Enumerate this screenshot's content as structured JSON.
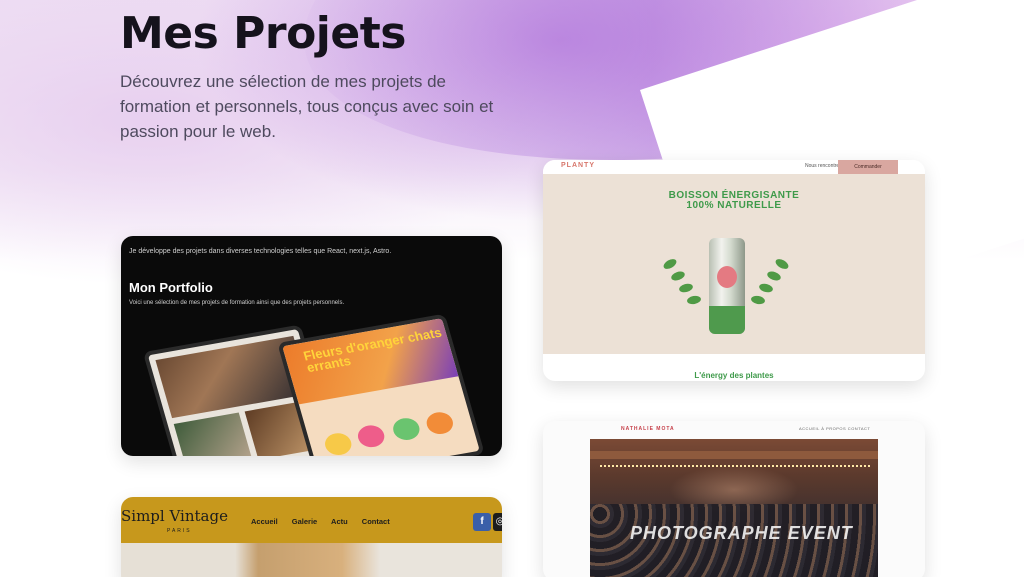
{
  "hero": {
    "title": "Mes Projets",
    "description": "Découvrez une sélection de mes projets de formation et personnels, tous conçus avec soin et passion pour le web."
  },
  "projects": [
    {
      "id": "portfolio",
      "intro": "Je développe des projets dans diverses technologies telles que React, next.js, Astro.",
      "title": "Mon Portfolio",
      "subtitle": "Voici une sélection de mes projets de formation ainsi que des projets personnels.",
      "screen_text": "Fleurs d'oranger chats errants"
    },
    {
      "id": "planty",
      "logo": "PLANTY",
      "nav_link": "Nous rencontrer",
      "cta": "Commander",
      "headline_line1": "BOISSON ÉNERGISANTE",
      "headline_line2": "100% NATURELLE",
      "tagline": "L'énergy des plantes"
    },
    {
      "id": "photographe",
      "name": "NATHALIE MOTA",
      "links": "ACCUEIL  À PROPOS  CONTACT",
      "overlay": "PHOTOGRAPHE EVENT"
    },
    {
      "id": "vintage",
      "brand": "Simpl Vintage",
      "brand_sub": "PARIS",
      "nav": [
        "Accueil",
        "Galerie",
        "Actu",
        "Contact"
      ],
      "social_facebook": "f",
      "social_instagram": "◎"
    }
  ],
  "colors": {
    "heading": "#15121c",
    "body_text": "#4e4a5e",
    "accent_purple": "#a65ed6",
    "planty_green": "#3e9a4a",
    "vintage_gold": "#c7981c"
  }
}
